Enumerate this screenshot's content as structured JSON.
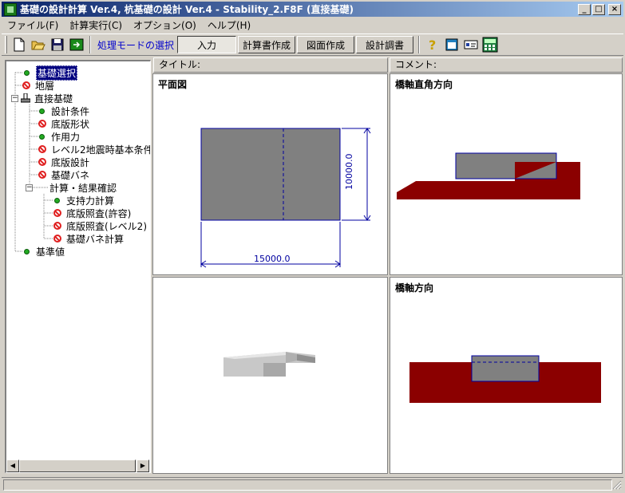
{
  "window": {
    "title": "基礎の設計計算 Ver.4, 杭基礎の設計 Ver.4 - Stability_2.F8F (直接基礎)",
    "minimize": "_",
    "maximize": "□",
    "close": "×"
  },
  "menu": [
    "ファイル(F)",
    "計算実行(C)",
    "オプション(O)",
    "ヘルプ(H)"
  ],
  "toolbar": {
    "mode_label": "処理モードの選択",
    "modes": [
      "入力",
      "計算書作成",
      "図面作成",
      "設計調書"
    ],
    "active_mode": "入力"
  },
  "tree": {
    "items": [
      {
        "label": "基礎選択",
        "status": "ok",
        "selected": true
      },
      {
        "label": "地層",
        "status": "no"
      },
      {
        "label": "直接基礎",
        "status": "folder"
      },
      {
        "label": "設計条件",
        "status": "ok"
      },
      {
        "label": "底版形状",
        "status": "no"
      },
      {
        "label": "作用力",
        "status": "ok"
      },
      {
        "label": "レベル2地震時基本条件",
        "status": "no"
      },
      {
        "label": "底版設計",
        "status": "no"
      },
      {
        "label": "基礎バネ",
        "status": "no"
      },
      {
        "label": "計算・結果確認",
        "status": "group"
      },
      {
        "label": "支持力計算",
        "status": "ok"
      },
      {
        "label": "底版照査(許容)",
        "status": "no"
      },
      {
        "label": "底版照査(レベル2)",
        "status": "no"
      },
      {
        "label": "基礎バネ計算",
        "status": "no"
      },
      {
        "label": "基準値",
        "status": "ok"
      }
    ]
  },
  "headers": {
    "title_label": "タイトル:",
    "comment_label": "コメント:"
  },
  "panes": {
    "plan": {
      "title": "平面図",
      "dim_width": "15000.0",
      "dim_depth": "10000.0"
    },
    "transverse": {
      "title": "橋軸直角方向"
    },
    "longitudinal": {
      "title": "橋軸方向"
    }
  },
  "colors": {
    "footing_fill": "#808080",
    "outline": "#0000a0",
    "ground": "#8b0000"
  }
}
